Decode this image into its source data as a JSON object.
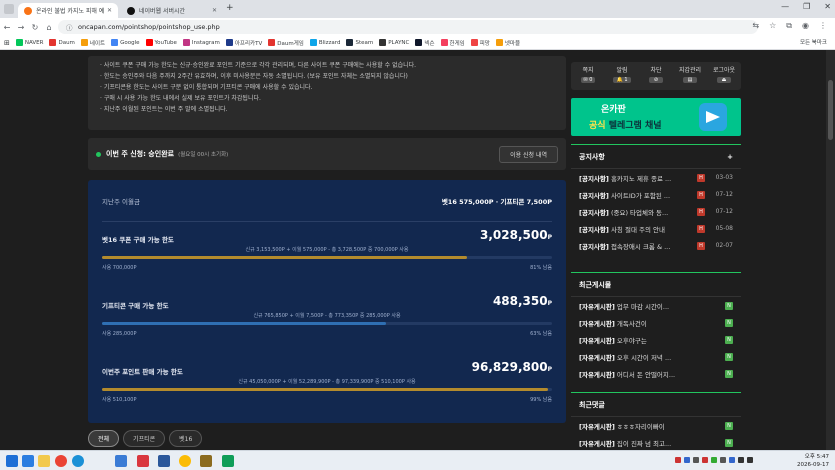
{
  "browser": {
    "tabs": [
      {
        "title": "온라인 불법 카지노 피해 예방 ...",
        "active": true,
        "color": "#f97316"
      },
      {
        "title": "네이버웹 서버시간",
        "active": false,
        "color": "#111111"
      }
    ],
    "newtab": "+",
    "url": "oncapan.com/pointshop/pointshop_use.php",
    "bookmarks": [
      {
        "label": "NAVER",
        "color": "#03c75a"
      },
      {
        "label": "Daum",
        "color": "#e3342f"
      },
      {
        "label": "네이트",
        "color": "#f59e0b"
      },
      {
        "label": "Google",
        "color": "#4285f4"
      },
      {
        "label": "YouTube",
        "color": "#ff0000"
      },
      {
        "label": "Instagram",
        "color": "#c13584"
      },
      {
        "label": "아프리카TV",
        "color": "#1e3a8a"
      },
      {
        "label": "Daum게임",
        "color": "#e3342f"
      },
      {
        "label": "Blizzard",
        "color": "#0ea5e9"
      },
      {
        "label": "Steam",
        "color": "#1b2838"
      },
      {
        "label": "PLAYNC",
        "color": "#333333"
      },
      {
        "label": "넥슨",
        "color": "#0f172a"
      },
      {
        "label": "한게임",
        "color": "#f43f5e"
      },
      {
        "label": "피망",
        "color": "#ef4444"
      },
      {
        "label": "넷마블",
        "color": "#f59e0b"
      }
    ],
    "all_bookmarks": "모든 북마크"
  },
  "notice": {
    "items": [
      "사이트 쿠폰 구매 가능 한도는 신규·승인완료 포인트 기준으로 각각 관리되며, 다른 사이트 쿠폰 구매에는 사용할 수 없습니다.",
      "한도는 승인주와 다음 주까지 2주간 유효하며, 이후 미사용분은 자동 소멸됩니다. (보유 포인트 자체는 소멸되지 않습니다)",
      "기프티콘용 한도는 사이트 구분 없이 통합되며 기프티콘 구매에 사용할 수 있습니다.",
      "구매 시 사용 가능 한도 내에서 실제 보유 포인트가 차감됩니다.",
      "지난주 이월된 포인트는 이번 주 말에 소멸됩니다."
    ]
  },
  "schedule": {
    "label": "이번 주 신청: 승인완료",
    "sub": "(월요일 00시 초기화)",
    "button": "이용 신청 내역"
  },
  "panel": {
    "prev_label": "지난주 이월금",
    "prev_value": "벳16 575,000P · 기프티콘 7,500P",
    "limits": [
      {
        "title": "벳16 쿠폰 구매 가능 한도",
        "amount": "3,028,500",
        "unit": "P",
        "calc": "신규 3,153,500P + 이월 575,000P - 총 3,728,500P 중 700,000P 사용",
        "used": "사용 700,000P",
        "remain": "81% 남음",
        "fill": 0.81,
        "color": "#b38b2d"
      },
      {
        "title": "기프티콘 구매 가능 한도",
        "amount": "488,350",
        "unit": "P",
        "calc": "신규 765,850P + 이월 7,500P - 총 773,350P 중 285,000P 사용",
        "used": "사용 285,000P",
        "remain": "63% 남음",
        "fill": 0.63,
        "color": "#2f6fb3"
      },
      {
        "title": "이번주 포인트 판매 가능 한도",
        "amount": "96,829,800",
        "unit": "P",
        "calc": "신규 45,050,000P + 이월 52,289,900P - 총 97,339,900P 중 510,100P 사용",
        "used": "사용 510,100P",
        "remain": "99% 남음",
        "fill": 0.99,
        "color": "#b38b2d"
      }
    ]
  },
  "filters": [
    "전체",
    "기프티콘",
    "벳16"
  ],
  "sidebar": {
    "userbar": [
      {
        "label": "쪽지",
        "value": "0"
      },
      {
        "label": "알림",
        "value": "1"
      },
      {
        "label": "차단",
        "value": "⊘"
      },
      {
        "label": "지갑관리",
        "value": "▤"
      },
      {
        "label": "로그아웃",
        "value": "⏏"
      }
    ],
    "banner": {
      "line1": "온카판",
      "line2_a": "공식",
      "line2_b": " 텔레그램 채널"
    },
    "notices": {
      "title": "공지사항",
      "plus": "+",
      "items": [
        {
          "tag": "[공지사항]",
          "text": "홍카지노 제휴 종료 ...",
          "date": "03-03"
        },
        {
          "tag": "[공지사항]",
          "text": "사이트ID가 포함된 ...",
          "date": "07-12"
        },
        {
          "tag": "[공지사항]",
          "text": "(중요) 타업체와 동...",
          "date": "07-12"
        },
        {
          "tag": "[공지사항]",
          "text": "사칭 절대 주의 안내",
          "date": "05-08"
        },
        {
          "tag": "[공지사항]",
          "text": "접속장애시 크롬 & ...",
          "date": "02-07"
        }
      ]
    },
    "recent_posts": {
      "title": "최근게시물",
      "items": [
        {
          "tag": "[자유게시판]",
          "text": "업무 마감 시간이..."
        },
        {
          "tag": "[자유게시판]",
          "text": "개독사건이"
        },
        {
          "tag": "[자유게시판]",
          "text": "오후야구는"
        },
        {
          "tag": "[자유게시판]",
          "text": "오후 시간이 저녁 ..."
        },
        {
          "tag": "[자유게시판]",
          "text": "어디서 돈 안떨어지..."
        }
      ]
    },
    "recent_comments": {
      "title": "최근댓글",
      "items": [
        {
          "tag": "[자유게시판]",
          "text": "ㅎㅎㅎ자리이빠이"
        },
        {
          "tag": "[자유게시판]",
          "text": "집이 진짜 넘 최고..."
        }
      ]
    },
    "badge_h": "H",
    "badge_n": "N"
  },
  "taskbar": {
    "time": "오후 5:47",
    "date": "2026-09-17"
  }
}
